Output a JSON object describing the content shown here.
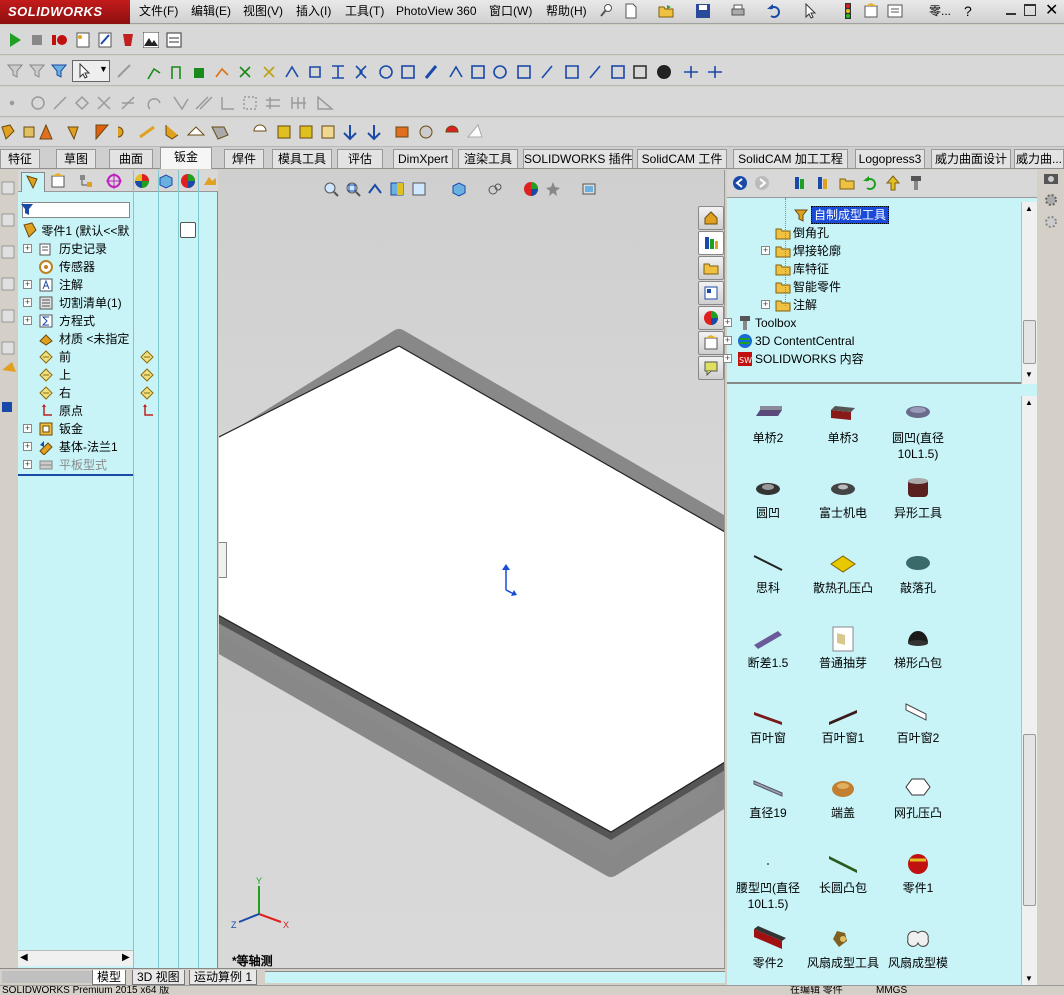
{
  "app": {
    "logo_text": "SOLIDWORKS",
    "brand_color": "#b31313",
    "menu": [
      "文件(F)",
      "编辑(E)",
      "视图(V)",
      "插入(I)",
      "工具(T)",
      "PhotoView 360",
      "窗口(W)",
      "帮助(H)"
    ],
    "search_hint": "零..."
  },
  "command_tabs": [
    "特征",
    "草图",
    "曲面",
    "钣金",
    "焊件",
    "模具工具",
    "评估",
    "DimXpert",
    "渲染工具",
    "SOLIDWORKS 插件",
    "SolidCAM 工件",
    "SolidCAM 加工工程",
    "Logopress3",
    "威力曲面设计",
    "威力曲..."
  ],
  "active_tab": "钣金",
  "feature_tree": {
    "filter_placeholder": "",
    "root": "零件1  (默认<<默",
    "items": [
      {
        "label": "历史记录",
        "icon": "history-icon",
        "expand": true
      },
      {
        "label": "传感器",
        "icon": "sensor-icon",
        "expand": false
      },
      {
        "label": "注解",
        "icon": "annotation-icon",
        "expand": true
      },
      {
        "label": "切割清单(1)",
        "icon": "cut-list-icon",
        "expand": true
      },
      {
        "label": "方程式",
        "icon": "equation-icon",
        "expand": true
      },
      {
        "label": "材质 <未指定",
        "icon": "material-icon",
        "expand": false
      },
      {
        "label": "前",
        "icon": "plane-icon",
        "expand": false
      },
      {
        "label": "上",
        "icon": "plane-icon",
        "expand": false
      },
      {
        "label": "右",
        "icon": "plane-icon",
        "expand": false
      },
      {
        "label": "原点",
        "icon": "origin-icon",
        "expand": false
      },
      {
        "label": "钣金",
        "icon": "sheet-metal-icon",
        "expand": true
      },
      {
        "label": "基体-法兰1",
        "icon": "base-flange-icon",
        "expand": true
      },
      {
        "label": "平板型式",
        "icon": "flat-pattern-icon",
        "expand": true,
        "dim": true
      }
    ]
  },
  "viewport": {
    "view_name": "*等轴测",
    "triad": {
      "x": "X",
      "y": "Y",
      "z": "Z"
    }
  },
  "bottom_tabs": [
    "模型",
    "3D 视图",
    "运动算例 1"
  ],
  "status": {
    "left": "SOLIDWORKS Premium 2015 x64 版",
    "middle": "在编辑 零件",
    "right": "MMGS"
  },
  "design_library": {
    "tree": [
      {
        "label": "自制成型工具",
        "level": 3,
        "selected": true
      },
      {
        "label": "倒角孔",
        "level": 2
      },
      {
        "label": "焊接轮廓",
        "level": 2,
        "expand": true
      },
      {
        "label": "库特征",
        "level": 2
      },
      {
        "label": "智能零件",
        "level": 2
      },
      {
        "label": "注解",
        "level": 2,
        "expand": true
      },
      {
        "label": "Toolbox",
        "level": 0,
        "expand": true
      },
      {
        "label": "3D ContentCentral",
        "level": 0,
        "expand": true
      },
      {
        "label": "SOLIDWORKS 内容",
        "level": 0,
        "expand": true
      }
    ],
    "items": [
      {
        "label": "单桥2",
        "color": "#5a4a7a"
      },
      {
        "label": "单桥3",
        "color": "#8a1a1a"
      },
      {
        "label": "圆凹(直径10L1.5)",
        "color": "#6a6a8a"
      },
      {
        "label": "圆凹",
        "color": "#333333"
      },
      {
        "label": "富士机电",
        "color": "#444444"
      },
      {
        "label": "异形工具",
        "color": "#5a2020"
      },
      {
        "label": "思科",
        "color": "#222222"
      },
      {
        "label": "散热孔压凸",
        "color": "#e8c800"
      },
      {
        "label": "敲落孔",
        "color": "#3a6a6a"
      },
      {
        "label": "断差1.5",
        "color": "#6a5a9a"
      },
      {
        "label": "普通抽芽",
        "color": "#d8c890"
      },
      {
        "label": "梯形凸包",
        "color": "#1a1a1a"
      },
      {
        "label": "百叶窗",
        "color": "#7a1a1a"
      },
      {
        "label": "百叶窗1",
        "color": "#3a1a1a"
      },
      {
        "label": "百叶窗2",
        "color": "#444444"
      },
      {
        "label": "直径19",
        "color": "#9aa0c0"
      },
      {
        "label": "端盖",
        "color": "#c08030"
      },
      {
        "label": "网孔压凸",
        "color": "#ffffff"
      },
      {
        "label": "腰型凹(直径10L1.5)",
        "color": "#555555"
      },
      {
        "label": "长圆凸包",
        "color": "#2a5a1a"
      },
      {
        "label": "零件1",
        "color": "#c01010"
      },
      {
        "label": "零件2",
        "color": "#a01010"
      },
      {
        "label": "风扇成型工具",
        "color": "#806020"
      },
      {
        "label": "风扇成型模",
        "color": "#f0f0f0"
      }
    ]
  }
}
